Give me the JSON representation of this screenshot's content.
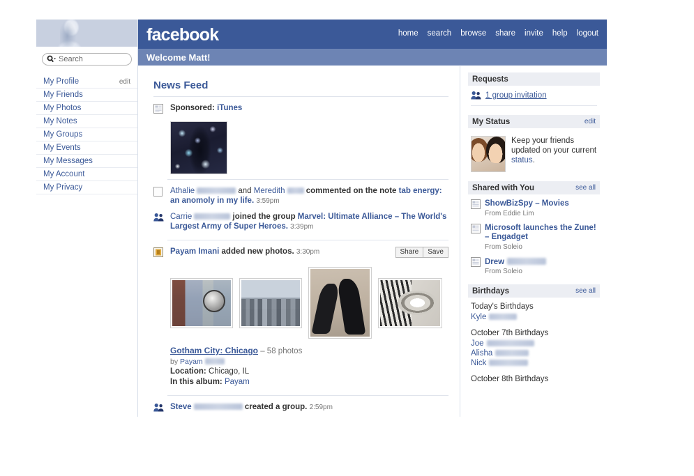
{
  "colors": {
    "brand_blue": "#3b5998",
    "welcome_bar": "#6d84b4",
    "section_header_bg": "#eceef3",
    "link": "#3b5998",
    "muted": "#777777"
  },
  "header": {
    "logo": "facebook",
    "welcome": "Welcome Matt!",
    "nav": [
      {
        "label": "home"
      },
      {
        "label": "search"
      },
      {
        "label": "browse"
      },
      {
        "label": "share"
      },
      {
        "label": "invite"
      },
      {
        "label": "help"
      },
      {
        "label": "logout"
      }
    ]
  },
  "sidebar": {
    "search": {
      "placeholder": "Search",
      "value": ""
    },
    "items": [
      {
        "label": "My Profile",
        "action": "edit"
      },
      {
        "label": "My Friends",
        "action": ""
      },
      {
        "label": "My Photos",
        "action": ""
      },
      {
        "label": "My Notes",
        "action": ""
      },
      {
        "label": "My Groups",
        "action": ""
      },
      {
        "label": "My Events",
        "action": ""
      },
      {
        "label": "My Messages",
        "action": ""
      },
      {
        "label": "My Account",
        "action": ""
      },
      {
        "label": "My Privacy",
        "action": ""
      }
    ]
  },
  "feed": {
    "title": "News Feed",
    "sponsored": {
      "label": "Sponsored:",
      "advertiser": "iTunes"
    },
    "stories": [
      {
        "icon": "note-icon",
        "name1": "Athalie",
        "name1_redacted": true,
        "conj": "and",
        "name2": "Meredith",
        "name2_redacted": true,
        "verb": "commented on the note",
        "object": "tab energy: an anomoly in my life.",
        "time": "3:59pm"
      },
      {
        "icon": "group-icon",
        "name1": "Carrie",
        "name1_redacted": true,
        "verb": "joined the group",
        "object": "Marvel: Ultimate Alliance – The World's Largest Army of Super Heroes.",
        "time": "3:39pm"
      }
    ],
    "photo_story": {
      "icon": "photo-icon",
      "actor": "Payam Imani",
      "verb": "added new photos.",
      "time": "3:30pm",
      "share_label": "Share",
      "save_label": "Save",
      "thumbs": [
        {
          "alt": "city-building-reflection"
        },
        {
          "alt": "chicago-skyline"
        },
        {
          "alt": "shadows-on-pavement"
        },
        {
          "alt": "spiral-staircase"
        }
      ],
      "album_name": "Gotham City: Chicago",
      "album_count": "– 58 photos",
      "by_label": "by",
      "by_name": "Payam",
      "by_name_redacted": true,
      "location_label": "Location:",
      "location_value": "Chicago, IL",
      "album_people_label": "In this album:",
      "album_people_value": "Payam"
    },
    "last_story": {
      "icon": "group-icon",
      "name1": "Steve",
      "name1_redacted": true,
      "verb": "created a group.",
      "time": "2:59pm"
    }
  },
  "right": {
    "requests": {
      "title": "Requests",
      "items": [
        {
          "icon": "group-icon",
          "label": "1 group invitation"
        }
      ]
    },
    "my_status": {
      "title": "My Status",
      "edit_label": "edit",
      "text_before": "Keep your friends updated on your current ",
      "link_text": "status",
      "text_after": "."
    },
    "shared_with_you": {
      "title": "Shared with You",
      "see_all": "see all",
      "items": [
        {
          "icon": "link-icon",
          "title": "ShowBizSpy – Movies",
          "from": "From Eddie Lim",
          "redacted": false
        },
        {
          "icon": "link-icon",
          "title": "Microsoft launches the Zune! – Engadget",
          "from": "From Soleio",
          "redacted": false
        },
        {
          "icon": "link-icon",
          "title": "Drew",
          "from": "From Soleio",
          "redacted": true
        }
      ]
    },
    "birthdays": {
      "title": "Birthdays",
      "see_all": "see all",
      "groups": [
        {
          "label": "Today's Birthdays",
          "names": [
            {
              "first": "Kyle",
              "redacted": true
            }
          ]
        },
        {
          "label": "October 7th Birthdays",
          "names": [
            {
              "first": "Joe",
              "redacted": true
            },
            {
              "first": "Alisha",
              "redacted": true
            },
            {
              "first": "Nick",
              "redacted": true
            }
          ]
        },
        {
          "label": "October 8th Birthdays",
          "names": []
        }
      ]
    }
  }
}
